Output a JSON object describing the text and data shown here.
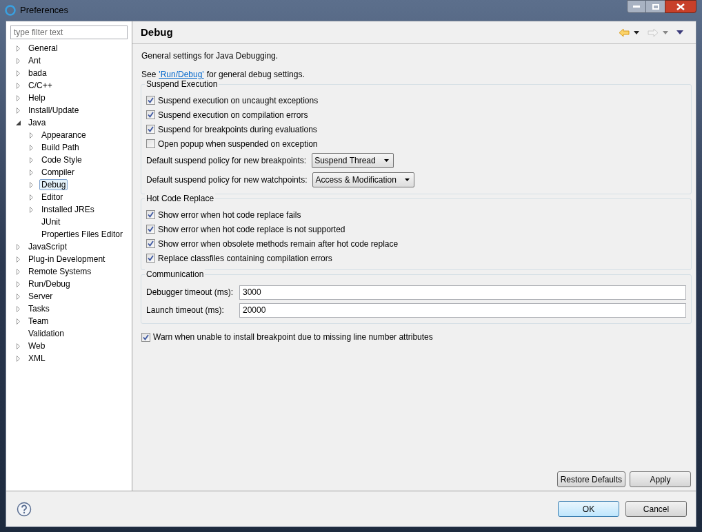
{
  "window": {
    "title": "Preferences"
  },
  "filter": {
    "placeholder": "type filter text"
  },
  "tree": [
    {
      "label": "General",
      "kind": "folder",
      "expanded": false,
      "selected": false
    },
    {
      "label": "Ant",
      "kind": "folder",
      "expanded": false,
      "selected": false
    },
    {
      "label": "bada",
      "kind": "folder",
      "expanded": false,
      "selected": false
    },
    {
      "label": "C/C++",
      "kind": "folder",
      "expanded": false,
      "selected": false
    },
    {
      "label": "Help",
      "kind": "folder",
      "expanded": false,
      "selected": false
    },
    {
      "label": "Install/Update",
      "kind": "folder",
      "expanded": false,
      "selected": false
    },
    {
      "label": "Java",
      "kind": "folder",
      "expanded": true,
      "selected": false,
      "children": [
        {
          "label": "Appearance",
          "kind": "folder",
          "expanded": false,
          "selected": false
        },
        {
          "label": "Build Path",
          "kind": "folder",
          "expanded": false,
          "selected": false
        },
        {
          "label": "Code Style",
          "kind": "folder",
          "expanded": false,
          "selected": false
        },
        {
          "label": "Compiler",
          "kind": "folder",
          "expanded": false,
          "selected": false
        },
        {
          "label": "Debug",
          "kind": "folder",
          "expanded": false,
          "selected": true
        },
        {
          "label": "Editor",
          "kind": "folder",
          "expanded": false,
          "selected": false
        },
        {
          "label": "Installed JREs",
          "kind": "folder",
          "expanded": false,
          "selected": false
        },
        {
          "label": "JUnit",
          "kind": "leaf",
          "selected": false
        },
        {
          "label": "Properties Files Editor",
          "kind": "leaf",
          "selected": false
        }
      ]
    },
    {
      "label": "JavaScript",
      "kind": "folder",
      "expanded": false,
      "selected": false
    },
    {
      "label": "Plug-in Development",
      "kind": "folder",
      "expanded": false,
      "selected": false
    },
    {
      "label": "Remote Systems",
      "kind": "folder",
      "expanded": false,
      "selected": false
    },
    {
      "label": "Run/Debug",
      "kind": "folder",
      "expanded": false,
      "selected": false
    },
    {
      "label": "Server",
      "kind": "folder",
      "expanded": false,
      "selected": false
    },
    {
      "label": "Tasks",
      "kind": "folder",
      "expanded": false,
      "selected": false
    },
    {
      "label": "Team",
      "kind": "folder",
      "expanded": false,
      "selected": false
    },
    {
      "label": "Validation",
      "kind": "leaf",
      "selected": false
    },
    {
      "label": "Web",
      "kind": "folder",
      "expanded": false,
      "selected": false
    },
    {
      "label": "XML",
      "kind": "folder",
      "expanded": false,
      "selected": false
    }
  ],
  "page": {
    "title": "Debug",
    "description": "General settings for Java Debugging.",
    "see_prefix": "See",
    "see_link": "'Run/Debug'",
    "see_suffix": "for general debug settings.",
    "groups": [
      {
        "title": "Suspend Execution",
        "rows": [
          {
            "kind": "checkbox",
            "label": "Suspend execution on uncaught exceptions",
            "checked": true
          },
          {
            "kind": "checkbox",
            "label": "Suspend execution on compilation errors",
            "checked": true
          },
          {
            "kind": "checkbox",
            "label": "Suspend for breakpoints during evaluations",
            "checked": true
          },
          {
            "kind": "checkbox",
            "label": "Open popup when suspended on exception",
            "checked": false
          },
          {
            "kind": "dropdown",
            "label": "Default suspend policy for new breakpoints:",
            "value": "Suspend Thread"
          },
          {
            "kind": "dropdown",
            "label": "Default suspend policy for new watchpoints:",
            "value": "Access & Modification"
          }
        ]
      },
      {
        "title": "Hot Code Replace",
        "rows": [
          {
            "kind": "checkbox",
            "label": "Show error when hot code replace fails",
            "checked": true
          },
          {
            "kind": "checkbox",
            "label": "Show error when hot code replace is not supported",
            "checked": true
          },
          {
            "kind": "checkbox",
            "label": "Show error when obsolete methods remain after hot code replace",
            "checked": true
          },
          {
            "kind": "checkbox",
            "label": "Replace classfiles containing compilation errors",
            "checked": true
          }
        ]
      },
      {
        "title": "Communication",
        "rows": [
          {
            "kind": "text",
            "label": "Debugger timeout (ms):",
            "value": "3000"
          },
          {
            "kind": "text",
            "label": "Launch timeout (ms):",
            "value": "20000"
          }
        ]
      }
    ],
    "warn": {
      "label": "Warn when unable to install breakpoint due to missing line number attributes",
      "checked": true
    },
    "buttons": [
      "Restore Defaults",
      "Apply"
    ]
  },
  "dialog_buttons": [
    "OK",
    "Cancel"
  ]
}
